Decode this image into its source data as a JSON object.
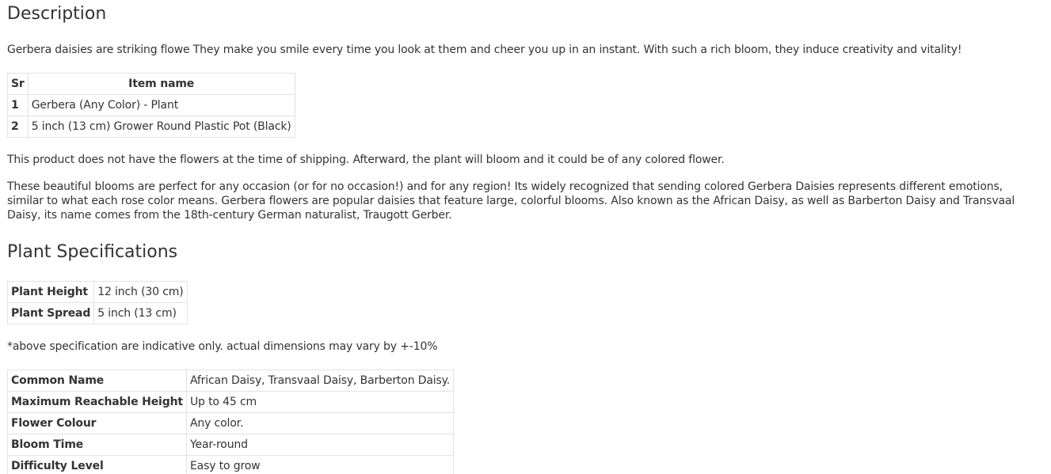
{
  "description": {
    "title": "Description",
    "intro": "Gerbera daisies are striking flowe They make you smile every time you look at them and cheer you up in an instant. With such a rich bloom, they induce creativity and vitality!",
    "items_table": {
      "headers": [
        "Sr",
        "Item name"
      ],
      "rows": [
        [
          "1",
          "Gerbera (Any Color) - Plant"
        ],
        [
          "2",
          "5 inch (13 cm) Grower Round Plastic Pot (Black)"
        ]
      ]
    },
    "note": "This product does not have the flowers at the time of shipping. Afterward, the plant will bloom and it could be of any colored flower.",
    "blooms": "These beautiful blooms are perfect for any occasion (or for no occasion!) and for any region! Its widely recognized that sending colored Gerbera Daisies represents different emotions, similar to what each rose color means. Gerbera flowers are popular daisies that feature large, colorful blooms. Also known as the African Daisy, as well as Barberton Daisy and Transvaal Daisy, its name comes from the 18th-century German naturalist, Traugott Gerber."
  },
  "specifications": {
    "title": "Plant Specifications",
    "size_table": [
      [
        "Plant Height",
        "12 inch (30 cm)"
      ],
      [
        "Plant Spread",
        "5 inch (13 cm)"
      ]
    ],
    "indicative_note": "*above specification are indicative only. actual dimensions may vary by +-10%",
    "details_table": [
      [
        "Common Name",
        "African Daisy, Transvaal Daisy, Barberton Daisy."
      ],
      [
        "Maximum Reachable Height",
        "Up to 45 cm"
      ],
      [
        "Flower Colour",
        "Any color."
      ],
      [
        "Bloom Time",
        "Year-round"
      ],
      [
        "Difficulty Level",
        "Easy to grow"
      ]
    ]
  }
}
